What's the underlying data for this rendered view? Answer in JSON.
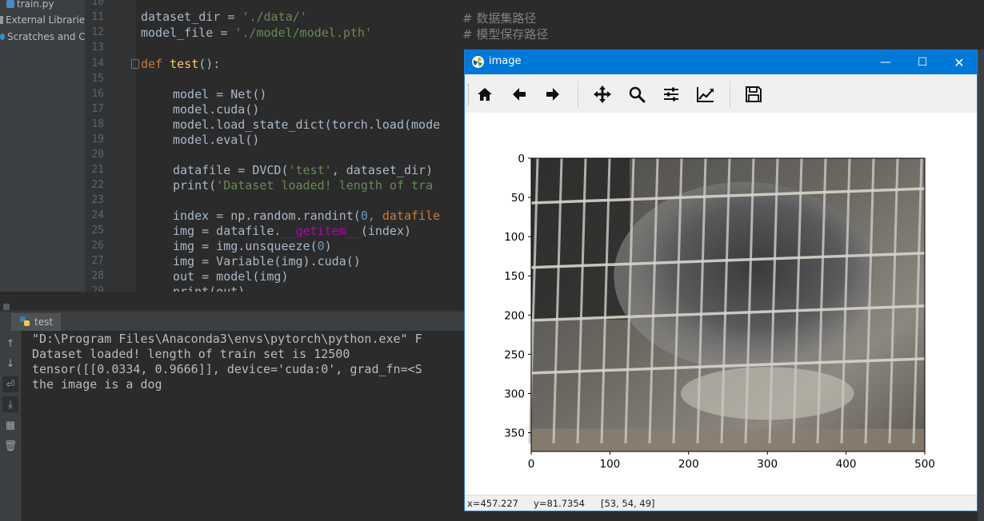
{
  "project": {
    "items": [
      "train.py",
      "External Libraries",
      "Scratches and Consoles"
    ]
  },
  "editor": {
    "line_numbers": [
      "10",
      "11",
      "12",
      "13",
      "14",
      "15",
      "16",
      "17",
      "18",
      "19",
      "20",
      "21",
      "22",
      "23",
      "24",
      "25",
      "26",
      "27",
      "28",
      "29"
    ],
    "lines": {
      "l11_a": "dataset_dir = ",
      "l11_b": "'./data/'",
      "l11_c": "# 数据集路径",
      "l12_a": "model_file = ",
      "l12_b": "'./model/model.pth'",
      "l12_c": "# 模型保存路径",
      "l14_kw": "def",
      "l14_fn": "test",
      "l14_rest": "():",
      "l16": "model = Net()",
      "l17": "model.cuda()",
      "l18": "model.load_state_dict(torch.load(mode",
      "l19": "model.eval()",
      "l21_a": "datafile = DVCD(",
      "l21_b": "'test'",
      "l21_c": ", dataset_dir)",
      "l22_a": "print(",
      "l22_b": "'Dataset loaded! length of tra",
      "l24_a": "index = np.random.randint(",
      "l24_b": "0",
      "l24_c": ", datafile",
      "l25_a": "img = datafile.",
      "l25_b": "__getitem__",
      "l25_c": "(index)",
      "l26_a": "img = img.unsqueeze(",
      "l26_b": "0",
      "l26_c": ")",
      "l27": "img = Variable(img).cuda()",
      "l28": "out = model(img)",
      "l29": "print(out)"
    }
  },
  "run": {
    "tab_label": "test",
    "console_lines": [
      "\"D:\\Program Files\\Anaconda3\\envs\\pytorch\\python.exe\" F",
      "Dataset loaded! length of train set is 12500",
      "tensor([[0.0334, 0.9666]], device='cuda:0', grad_fn=<S",
      "the image is a dog"
    ]
  },
  "figure": {
    "title": "image",
    "status": {
      "x": "x=457.227",
      "y": "y=81.7354",
      "rgb": "[53, 54, 49]"
    },
    "toolbar_icons": [
      "home-icon",
      "back-arrow-icon",
      "forward-arrow-icon",
      "pan-icon",
      "zoom-icon",
      "configure-subplots-icon",
      "edit-axis-icon",
      "save-icon"
    ]
  },
  "chart_data": {
    "type": "image",
    "x_ticks": [
      0,
      100,
      200,
      300,
      400,
      500
    ],
    "y_ticks": [
      0,
      50,
      100,
      150,
      200,
      250,
      300,
      350
    ],
    "xlim": [
      0,
      500
    ],
    "ylim": [
      374,
      0
    ],
    "content": "photo of a dog inside a metal wire cage"
  },
  "colors": {
    "titlebar": "#0078d7",
    "ide_background": "#2b2b2b",
    "keyword": "#cc7832",
    "string": "#6a8759"
  }
}
